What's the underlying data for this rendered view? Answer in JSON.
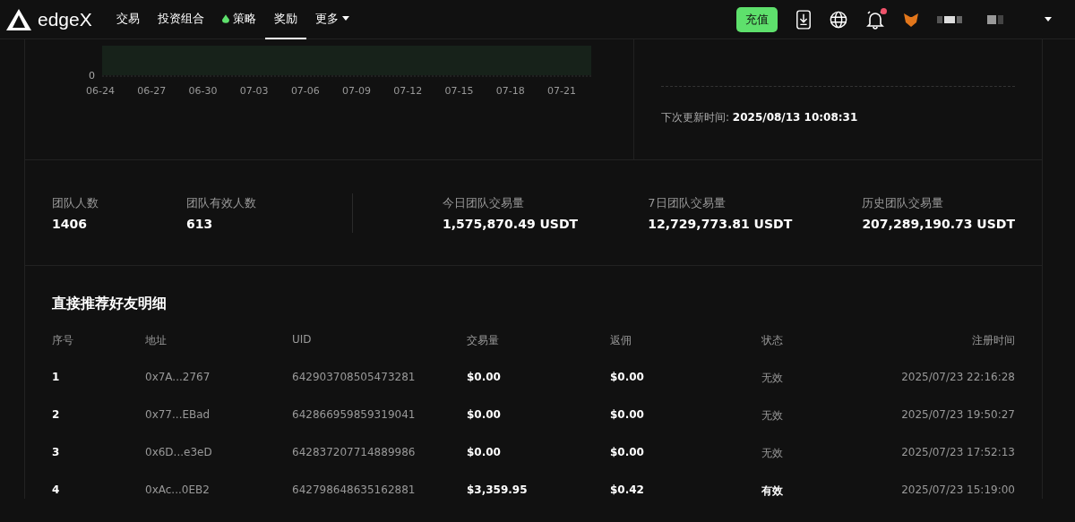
{
  "nav": {
    "brand": "edgeX",
    "items": [
      {
        "label": "交易",
        "selected": false,
        "kind": "plain"
      },
      {
        "label": "投资组合",
        "selected": false,
        "kind": "plain"
      },
      {
        "label": "策略",
        "selected": false,
        "kind": "drop"
      },
      {
        "label": "奖励",
        "selected": true,
        "kind": "plain"
      },
      {
        "label": "更多",
        "selected": false,
        "kind": "menu"
      }
    ],
    "deposit_button": "充值",
    "notification_unread": true
  },
  "chart": {
    "y_tick": "0",
    "x_labels": [
      "06-24",
      "06-27",
      "06-30",
      "07-03",
      "07-06",
      "07-09",
      "07-12",
      "07-15",
      "07-18",
      "07-21"
    ]
  },
  "next_update": {
    "label": "下次更新时间:",
    "value": "2025/08/13 10:08:31"
  },
  "stats_left": [
    {
      "label": "团队人数",
      "value": "1406"
    },
    {
      "label": "团队有效人数",
      "value": "613"
    }
  ],
  "stats_right": [
    {
      "label": "今日团队交易量",
      "value": "1,575,870.49 USDT"
    },
    {
      "label": "7日团队交易量",
      "value": "12,729,773.81 USDT"
    },
    {
      "label": "历史团队交易量",
      "value": "207,289,190.73 USDT"
    }
  ],
  "table": {
    "title": "直接推荐好友明细",
    "columns": [
      "序号",
      "地址",
      "UID",
      "交易量",
      "返佣",
      "状态",
      "注册时间"
    ],
    "rows": [
      {
        "no": "1",
        "address": "0x7A...2767",
        "uid": "642903708505473281",
        "volume": "$0.00",
        "rebate": "$0.00",
        "status": "无效",
        "valid": false,
        "time": "2025/07/23 22:16:28"
      },
      {
        "no": "2",
        "address": "0x77...EBad",
        "uid": "642866959859319041",
        "volume": "$0.00",
        "rebate": "$0.00",
        "status": "无效",
        "valid": false,
        "time": "2025/07/23 19:50:27"
      },
      {
        "no": "3",
        "address": "0x6D...e3eD",
        "uid": "642837207714889986",
        "volume": "$0.00",
        "rebate": "$0.00",
        "status": "无效",
        "valid": false,
        "time": "2025/07/23 17:52:13"
      },
      {
        "no": "4",
        "address": "0xAc...0EB2",
        "uid": "642798648635162881",
        "volume": "$3,359.95",
        "rebate": "$0.42",
        "status": "有效",
        "valid": true,
        "time": "2025/07/23 15:19:00"
      }
    ]
  }
}
